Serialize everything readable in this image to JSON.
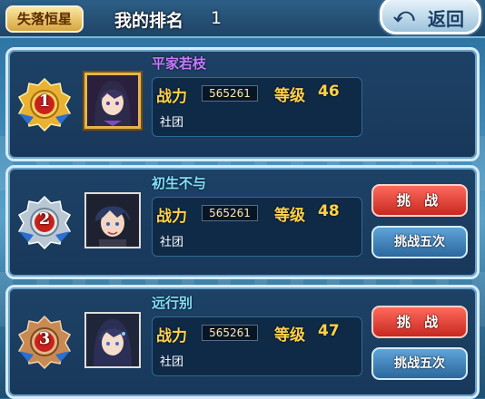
{
  "header": {
    "tab_label": "失落恒星",
    "rank_title": "我的排名",
    "rank_value": "1",
    "back_label": "返回"
  },
  "labels": {
    "power": "战力",
    "level": "等级",
    "guild": "社团",
    "challenge": "挑 战",
    "challenge_five": "挑战五次"
  },
  "entries": [
    {
      "rank": "1",
      "medal": "gold",
      "name": "平家若枝",
      "name_color": "#c77cff",
      "power": "565261",
      "level": "46",
      "has_buttons": false
    },
    {
      "rank": "2",
      "medal": "silver",
      "name": "初生不与",
      "name_color": "#7fe0ff",
      "power": "565261",
      "level": "48",
      "has_buttons": true
    },
    {
      "rank": "3",
      "medal": "bronze",
      "name": "远行别",
      "name_color": "#7fe0ff",
      "power": "565261",
      "level": "47",
      "has_buttons": true
    }
  ],
  "colors": {
    "gold": "#e9b232",
    "silver": "#b9c7d4",
    "bronze": "#c88a52",
    "ribbon_red": "#c9221c",
    "ribbon_blue": "#2a6fd1"
  }
}
